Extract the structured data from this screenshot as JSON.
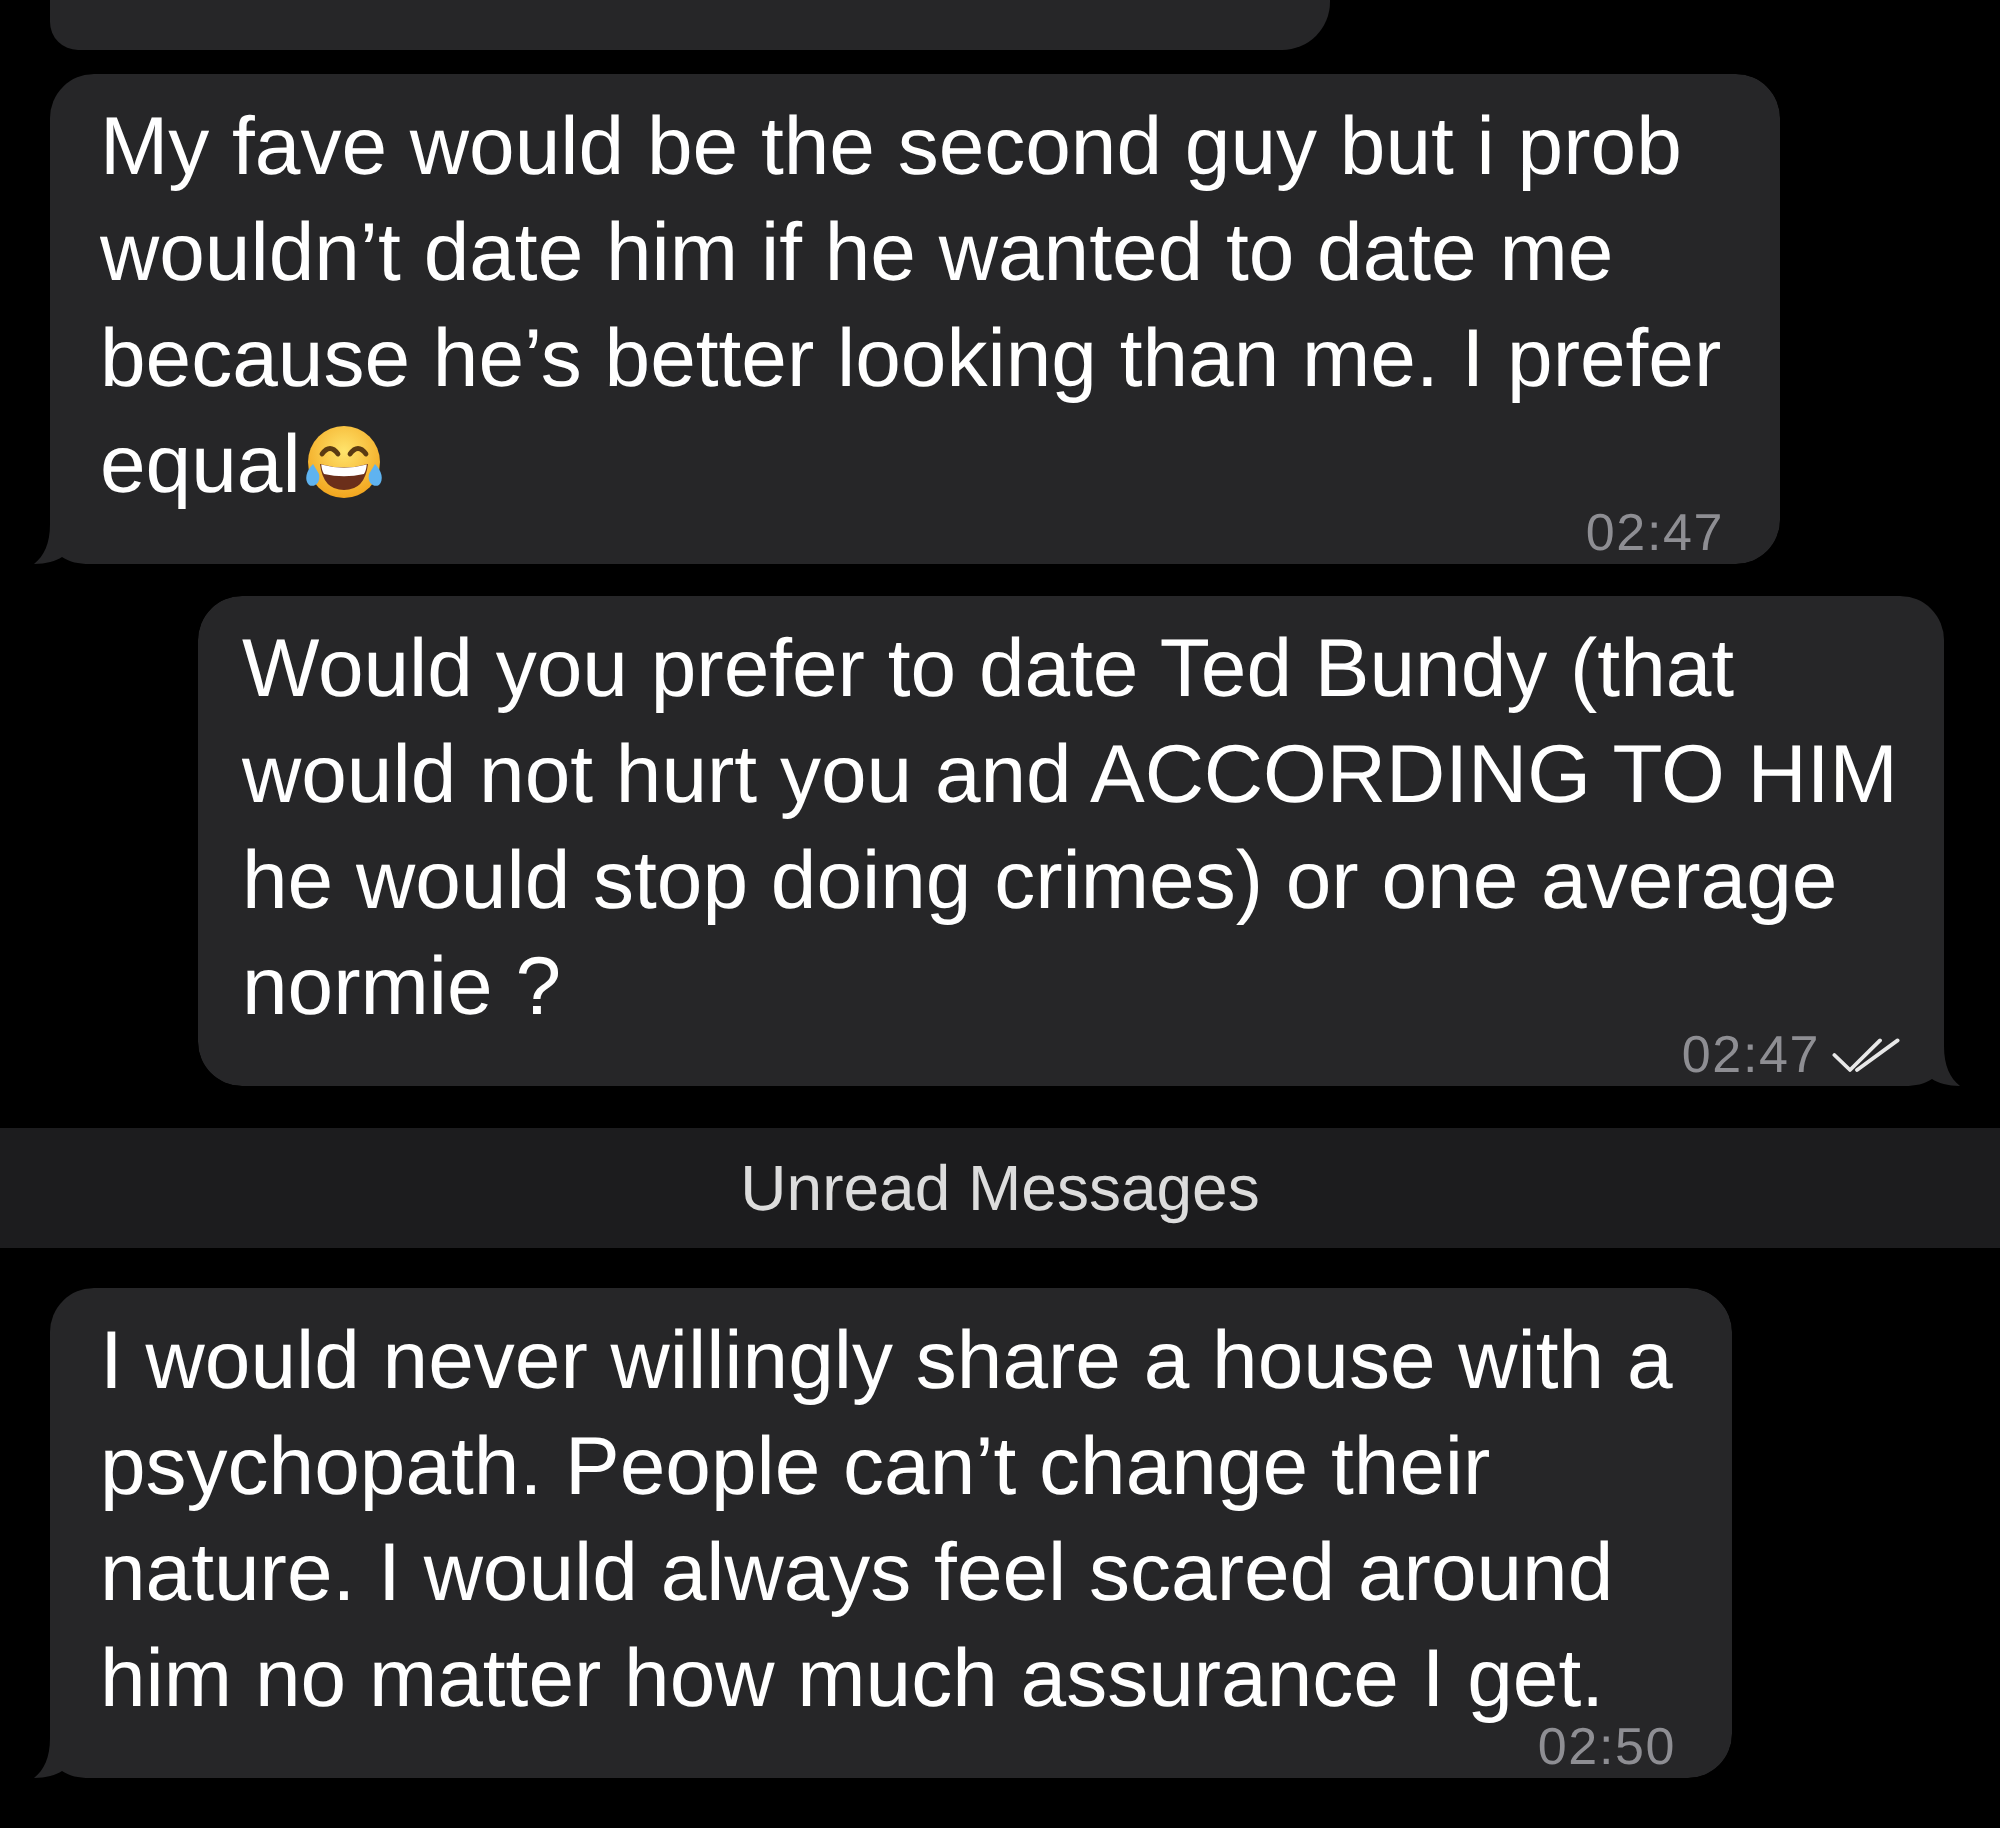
{
  "items": [
    {
      "kind": "fragment",
      "outgoing": false
    },
    {
      "kind": "message",
      "outgoing": false,
      "text": "My fave would be the second guy but i prob wouldn’t date him if he wanted to date me because he’s better looking than me. I prefer equal",
      "emoji": true,
      "time": "02:47",
      "tail": true
    },
    {
      "kind": "message",
      "outgoing": true,
      "text": "Would you prefer to date Ted Bundy (that would not hurt you and ACCORDING TO HIM he would stop doing crimes) or one average normie ?",
      "time": "02:47",
      "read": true,
      "tail": true
    },
    {
      "kind": "divider",
      "label": "Unread Messages"
    },
    {
      "kind": "message",
      "outgoing": false,
      "text": "I would never willingly share a house with a psychopath. People can’t change their nature. I would always feel scared around him no matter how much assurance I get.",
      "time": "02:50",
      "tail": true
    }
  ]
}
